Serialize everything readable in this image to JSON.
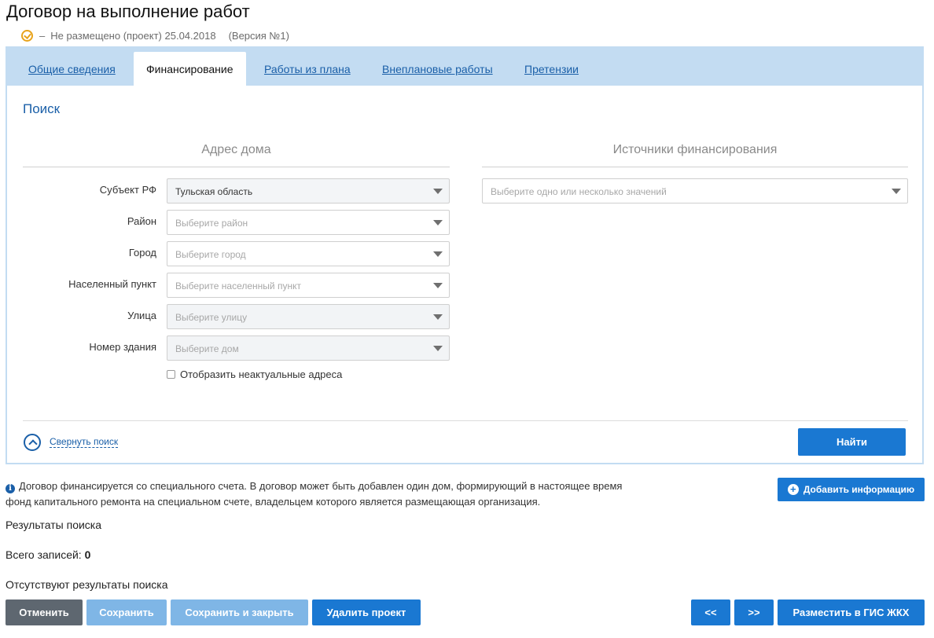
{
  "page": {
    "title": "Договор на выполнение работ",
    "status": "Не размещено (проект) 25.04.2018",
    "status_dash": "–",
    "version": "(Версия №1)"
  },
  "tabs": [
    {
      "label": "Общие сведения",
      "active": false
    },
    {
      "label": "Финансирование",
      "active": true
    },
    {
      "label": "Работы из плана",
      "active": false
    },
    {
      "label": "Внеплановые работы",
      "active": false
    },
    {
      "label": "Претензии",
      "active": false
    }
  ],
  "search": {
    "title": "Поиск",
    "address_section": "Адрес дома",
    "funding_section": "Источники финансирования",
    "fields": [
      {
        "label": "Субъект РФ",
        "value": "Тульская область"
      },
      {
        "label": "Район",
        "placeholder": "Выберите район"
      },
      {
        "label": "Город",
        "placeholder": "Выберите город"
      },
      {
        "label": "Населенный пункт",
        "placeholder": "Выберите населенный пункт"
      },
      {
        "label": "Улица",
        "placeholder": "Выберите улицу"
      },
      {
        "label": "Номер здания",
        "placeholder": "Выберите дом"
      }
    ],
    "funding_placeholder": "Выберите одно или несколько значений",
    "show_outdated_label": "Отобразить неактуальные адреса",
    "collapse_label": "Свернуть поиск",
    "find_button": "Найти"
  },
  "info": {
    "icon": "info-icon",
    "text_line1": "Договор финансируется со специального счета. В договор может быть добавлен один дом, формирующий в настоящее время",
    "text_line2": "фонд капитального ремонта на специальном счете, владельцем которого является размещающая организация.",
    "add_button": "Добавить информацию"
  },
  "results": {
    "title": "Результаты поиска",
    "total_label": "Всего записей:",
    "total_value": "0",
    "empty_message": "Отсутствуют результаты поиска"
  },
  "footer": {
    "cancel": "Отменить",
    "save": "Сохранить",
    "save_close": "Сохранить и закрыть",
    "delete_project": "Удалить проект",
    "prev": "<<",
    "next": ">>",
    "publish": "Разместить в ГИС ЖКХ"
  },
  "colors": {
    "accent": "#1a78d2",
    "link": "#1a5fa8",
    "tab_bar": "#c3dcf2",
    "status_icon": "#e8a31b",
    "disabled_button": "#7fb6e6",
    "cancel_button": "#5e6770"
  }
}
